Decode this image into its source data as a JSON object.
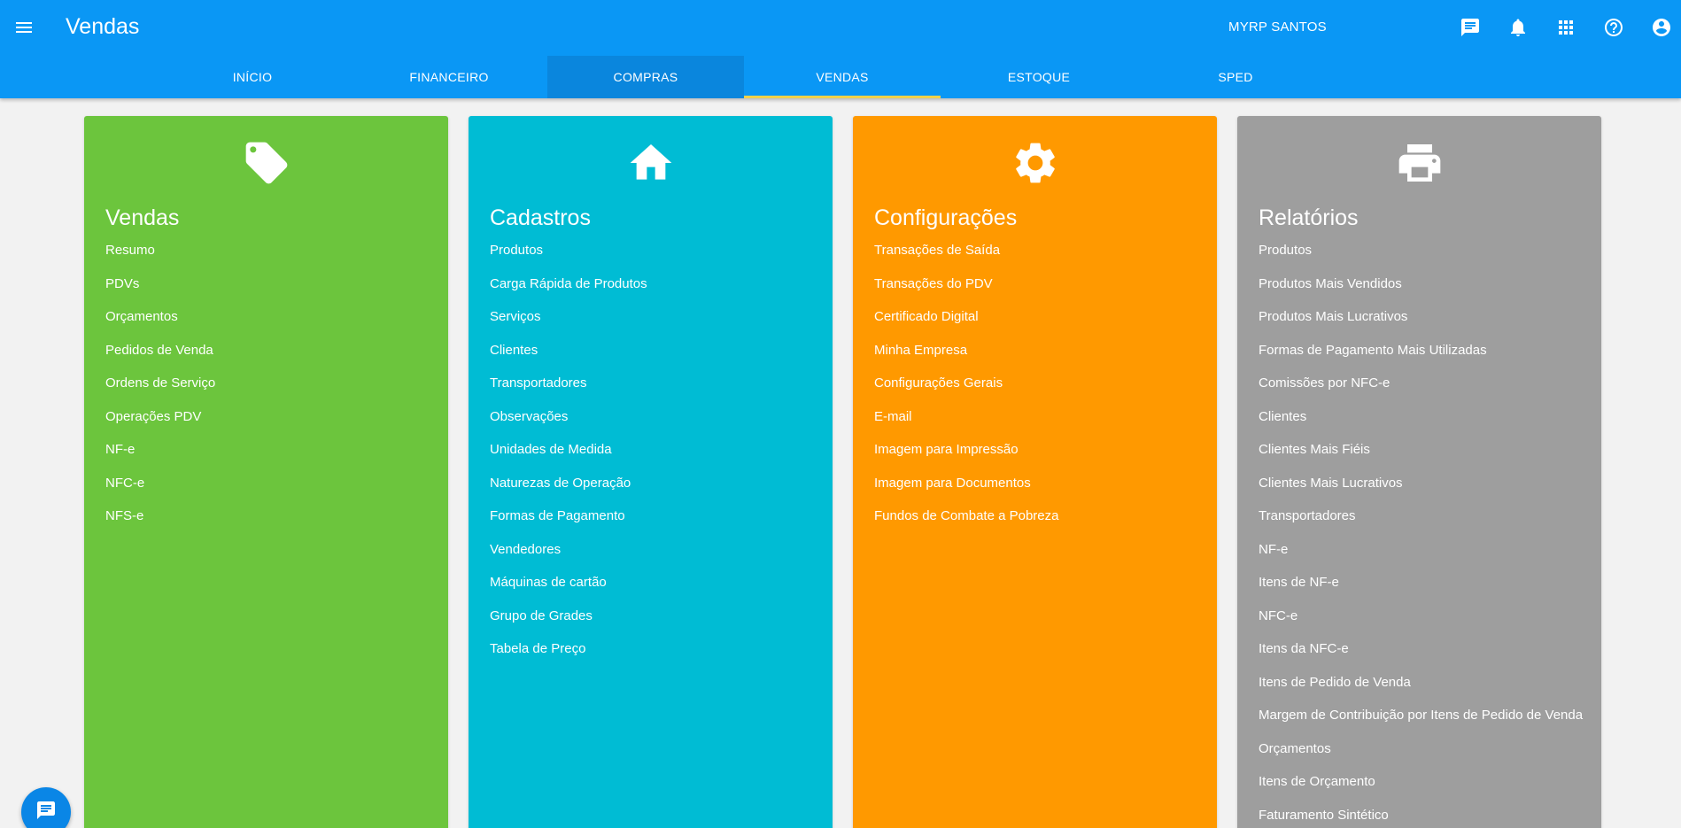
{
  "header": {
    "title": "Vendas",
    "user": "MYRP SANTOS",
    "icons": [
      "menu-icon",
      "message-icon",
      "bell-icon",
      "apps-grid-icon",
      "help-icon",
      "account-circle-icon"
    ],
    "color": "#0a97f5"
  },
  "tabs": [
    {
      "label": "INÍCIO",
      "highlighted": false,
      "active": false
    },
    {
      "label": "FINANCEIRO",
      "highlighted": false,
      "active": false
    },
    {
      "label": "COMPRAS",
      "highlighted": true,
      "active": false
    },
    {
      "label": "VENDAS",
      "highlighted": false,
      "active": true
    },
    {
      "label": "ESTOQUE",
      "highlighted": false,
      "active": false
    },
    {
      "label": "SPED",
      "highlighted": false,
      "active": false
    }
  ],
  "cards": [
    {
      "title": "Vendas",
      "icon": "tag-icon",
      "color": "#6cc53d",
      "links": [
        "Resumo",
        "PDVs",
        "Orçamentos",
        "Pedidos de Venda",
        "Ordens de Serviço",
        "Operações PDV",
        "NF-e",
        "NFC-e",
        "NFS-e"
      ]
    },
    {
      "title": "Cadastros",
      "icon": "home-icon",
      "color": "#00bcd4",
      "links": [
        "Produtos",
        "Carga Rápida de Produtos",
        "Serviços",
        "Clientes",
        "Transportadores",
        "Observações",
        "Unidades de Medida",
        "Naturezas de Operação",
        "Formas de Pagamento",
        "Vendedores",
        "Máquinas de cartão",
        "Grupo de Grades",
        "Tabela de Preço"
      ]
    },
    {
      "title": "Configurações",
      "icon": "gear-icon",
      "color": "#ff9900",
      "links": [
        "Transações de Saída",
        "Transações do PDV",
        "Certificado Digital",
        "Minha Empresa",
        "Configurações Gerais",
        "E-mail",
        "Imagem para Impressão",
        "Imagem para Documentos",
        "Fundos de Combate a Pobreza"
      ]
    },
    {
      "title": "Relatórios",
      "icon": "printer-icon",
      "color": "#9e9e9e",
      "links": [
        "Produtos",
        "Produtos Mais Vendidos",
        "Produtos Mais Lucrativos",
        "Formas de Pagamento Mais Utilizadas",
        "Comissões por NFC-e",
        "Clientes",
        "Clientes Mais Fiéis",
        "Clientes Mais Lucrativos",
        "Transportadores",
        "NF-e",
        "Itens de NF-e",
        "NFC-e",
        "Itens da NFC-e",
        "Itens de Pedido de Venda",
        "Margem de Contribuição por Itens de Pedido de Venda",
        "Orçamentos",
        "Itens de Orçamento",
        "Faturamento Sintético"
      ]
    }
  ],
  "fab": {
    "icon": "chat-icon",
    "color": "#0a86e6"
  }
}
